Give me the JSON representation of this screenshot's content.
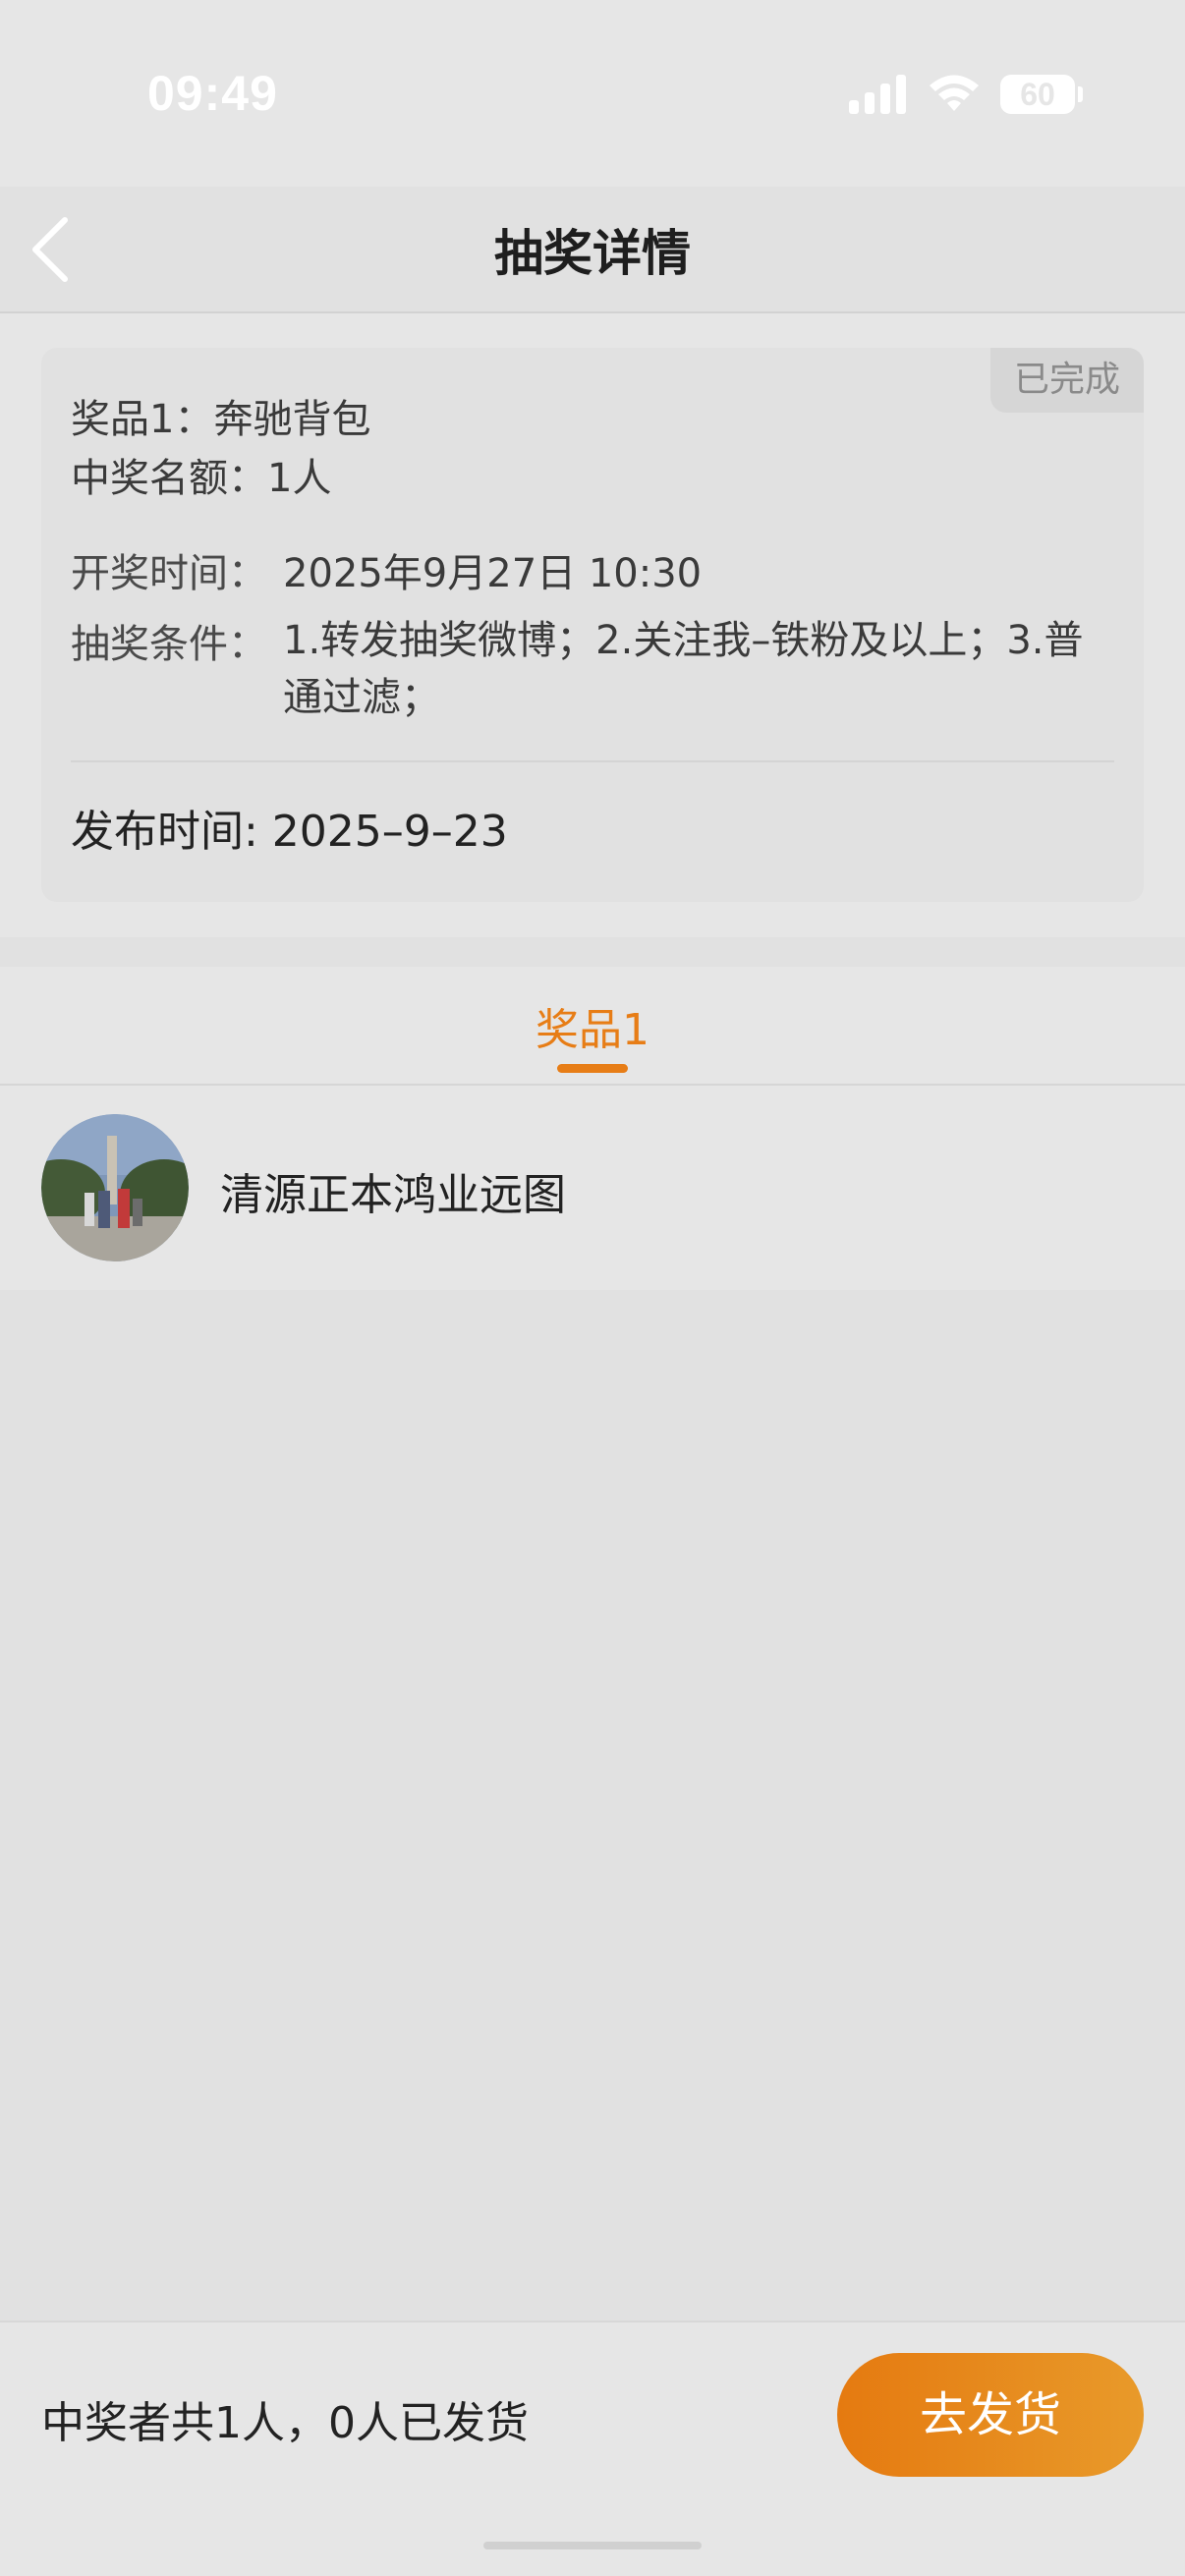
{
  "status_bar": {
    "time": "09:49",
    "battery": "60",
    "icons": [
      "signal-icon",
      "wifi-icon",
      "battery-icon"
    ]
  },
  "nav": {
    "back_icon": "chevron-left-icon",
    "title": "抽奖详情"
  },
  "info": {
    "status": "已完成",
    "prize_line": "奖品1：奔驰背包",
    "quota_line": "中奖名额：1人",
    "draw_time_label": "开奖时间：",
    "draw_time_value": "2025年9月27日 10:30",
    "condition_label": "抽奖条件：",
    "condition_value": "1.转发抽奖微博；2.关注我–铁粉及以上；3.普通过滤；",
    "publish_line": "发布时间: 2025–9–23"
  },
  "tabs": [
    {
      "label": "奖品1",
      "active": true
    }
  ],
  "winners": [
    {
      "name": "清源正本鸿业远图",
      "avatar": "avatar-photo"
    }
  ],
  "footer": {
    "summary": "中奖者共1人，0人已发货",
    "ship_button": "去发货"
  },
  "colors": {
    "accent": "#e77d16",
    "background": "#e1e1e1",
    "surface": "#e6e6e6"
  }
}
